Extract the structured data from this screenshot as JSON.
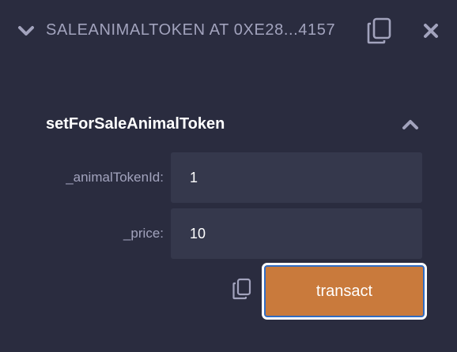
{
  "header": {
    "contract_title": "SALEANIMALTOKEN AT 0XE28...4157",
    "collapse_icon": "chevron-down-icon",
    "copy_icon": "copy-icon",
    "close_icon": "close-icon"
  },
  "function": {
    "name": "setForSaleAnimalToken",
    "collapse_icon": "chevron-up-icon",
    "params": [
      {
        "label": "_animalTokenId:",
        "value": "1"
      },
      {
        "label": "_price:",
        "value": "10"
      }
    ],
    "copy_icon": "copy-icon",
    "action_label": "transact"
  },
  "colors": {
    "background": "#2a2c3f",
    "input_background": "#35384c",
    "muted_text": "#a2a3bd",
    "primary_text": "#ffffff",
    "transact_button": "#c97a3c",
    "focus_ring": "#2f6cc4"
  }
}
